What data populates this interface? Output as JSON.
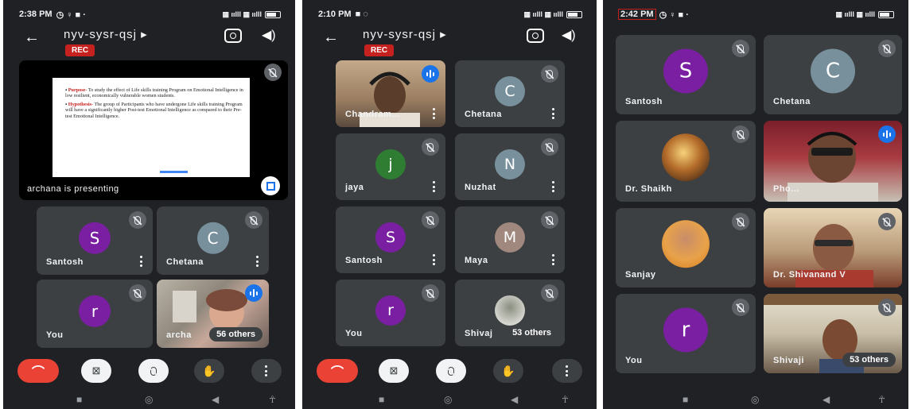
{
  "meeting_code": "nyv-sysr-qsj",
  "rec_label": "REC",
  "others_suffix": "others",
  "colors": {
    "end_call": "#ea4335",
    "rec": "#c5221f",
    "tile": "#3c4043",
    "background": "#202124",
    "speaking": "#1a73e8"
  },
  "icons": [
    "back-arrow-icon",
    "switch-camera-icon",
    "speaker-icon",
    "mic-off-icon",
    "audio-level-icon",
    "more-vert-icon",
    "end-call-icon",
    "camera-off-icon",
    "raise-hand-icon",
    "fullscreen-icon"
  ],
  "screens": [
    {
      "time": "2:38 PM",
      "presenting_label": "archana is presenting",
      "slide": {
        "purpose_heading": "Purpose-",
        "purpose_text": "To study the effect of Life skills training Program on Emotional Intelligence in low resilient, economically vulnerable women students.",
        "hypothesis_heading": "Hypothesis-",
        "hypothesis_text": "The group of Participants who have undergone Life skills training Program will have a significantly higher Post-test Emotional Intelligence as compared to their Pre-test Emotional Intelligence."
      },
      "tiles": [
        {
          "name": "Santosh",
          "initial": "S",
          "color": "#7b1fa2"
        },
        {
          "name": "Chetana",
          "initial": "C",
          "color": "#78909c"
        },
        {
          "name": "You",
          "initial": "r",
          "color": "#7b1fa2"
        },
        {
          "name": "archa",
          "others_count": "56"
        }
      ]
    },
    {
      "time": "2:10 PM",
      "tiles": [
        {
          "name": "Chandram..."
        },
        {
          "name": "Chetana",
          "initial": "C",
          "color": "#78909c"
        },
        {
          "name": "jaya",
          "initial": "j",
          "color": "#2e7d32"
        },
        {
          "name": "Nuzhat",
          "initial": "N",
          "color": "#78909c"
        },
        {
          "name": "Santosh",
          "initial": "S",
          "color": "#7b1fa2"
        },
        {
          "name": "Maya",
          "initial": "M",
          "color": "#a1887f"
        },
        {
          "name": "You",
          "initial": "r",
          "color": "#7b1fa2"
        },
        {
          "name": "Shivaj",
          "others_count": "53"
        }
      ]
    },
    {
      "time": "2:42 PM",
      "tiles": [
        {
          "name": "Santosh",
          "initial": "S",
          "color": "#7b1fa2"
        },
        {
          "name": "Chetana",
          "initial": "C",
          "color": "#78909c"
        },
        {
          "name": "Dr. Shaikh"
        },
        {
          "name": "Pho..."
        },
        {
          "name": "Sanjay"
        },
        {
          "name": "Dr. Shivanand V"
        },
        {
          "name": "You",
          "initial": "r",
          "color": "#7b1fa2"
        },
        {
          "name": "Shivaji",
          "others_count": "53"
        }
      ]
    }
  ]
}
